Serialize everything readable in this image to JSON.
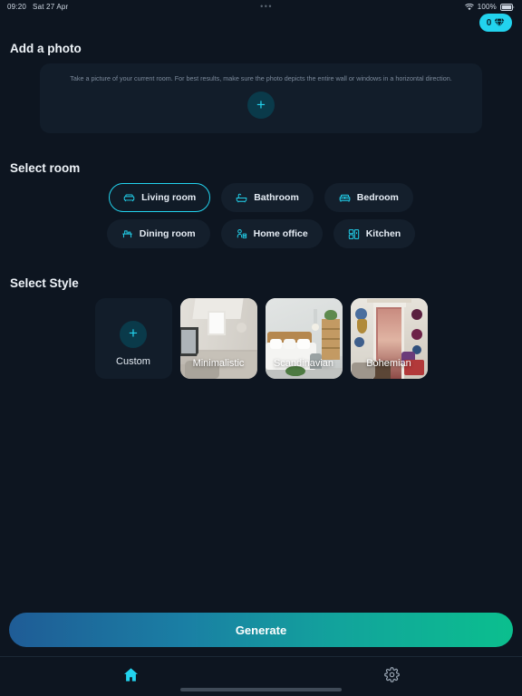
{
  "status_bar": {
    "time": "09:20",
    "date": "Sat 27 Apr",
    "dots": "•••",
    "battery_percent": "100%"
  },
  "credits_badge": {
    "count": "0",
    "icon": "gem-icon"
  },
  "photo_section": {
    "title": "Add a photo",
    "hint": "Take a picture of your current room. For best results, make sure the photo depicts the entire wall or windows in a horizontal direction.",
    "add_button_icon": "plus-icon"
  },
  "room_section": {
    "title": "Select room",
    "rows": [
      [
        {
          "label": "Living room",
          "icon": "sofa-icon",
          "selected": true
        },
        {
          "label": "Bathroom",
          "icon": "bathtub-icon",
          "selected": false
        },
        {
          "label": "Bedroom",
          "icon": "bed-icon",
          "selected": false
        }
      ],
      [
        {
          "label": "Dining room",
          "icon": "dining-table-icon",
          "selected": false
        },
        {
          "label": "Home office",
          "icon": "desk-chair-icon",
          "selected": false
        },
        {
          "label": "Kitchen",
          "icon": "kitchen-icon",
          "selected": false
        }
      ]
    ]
  },
  "style_section": {
    "title": "Select Style",
    "cards": [
      {
        "label": "Custom",
        "type": "custom",
        "icon": "plus-icon"
      },
      {
        "label": "Minimalistic",
        "type": "photo"
      },
      {
        "label": "Scandinavian",
        "type": "photo"
      },
      {
        "label": "Bohemian",
        "type": "photo"
      }
    ]
  },
  "generate_button": {
    "label": "Generate"
  },
  "tab_bar": {
    "tabs": [
      {
        "name": "home",
        "icon": "home-icon",
        "active": true
      },
      {
        "name": "settings",
        "icon": "gear-icon",
        "active": false
      }
    ]
  },
  "colors": {
    "background": "#0d1520",
    "card": "#121d2a",
    "accent": "#22d3ee",
    "generate_gradient_start": "#1f5c96",
    "generate_gradient_end": "#0bbf8e"
  }
}
